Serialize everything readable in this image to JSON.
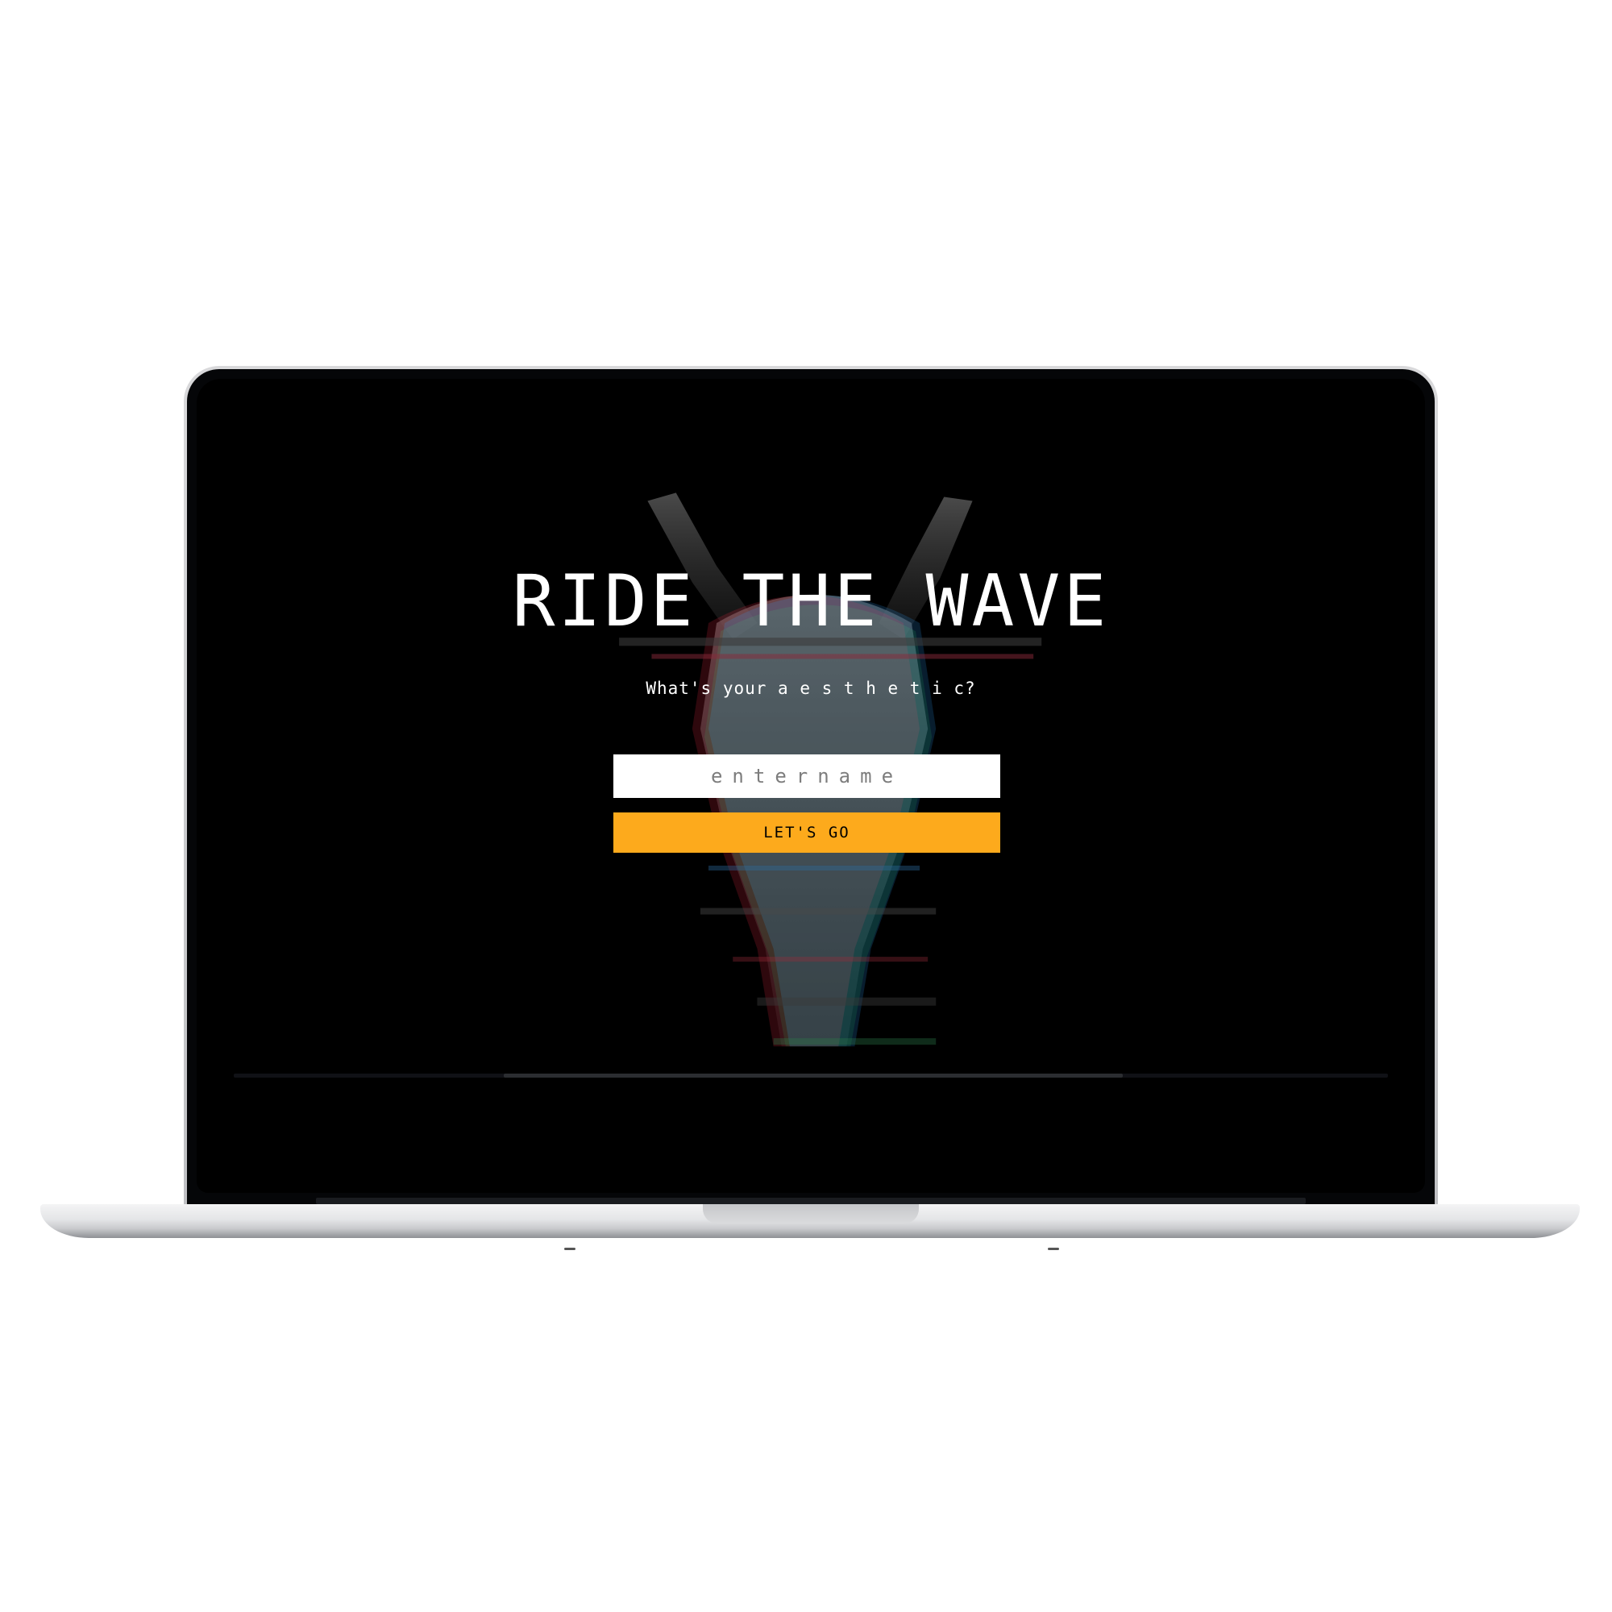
{
  "app": {
    "title": "RIDE THE WAVE",
    "subtitle": "What's your a e s t h e t i c?",
    "name_input": {
      "value": "",
      "placeholder": "entername"
    },
    "submit_label": "LET'S GO"
  },
  "colors": {
    "background": "#000000",
    "accent": "#fdaa1c",
    "text": "#ffffff"
  },
  "decoration": {
    "artwork": "glitched-statue-image",
    "device": "laptop-mockup"
  }
}
